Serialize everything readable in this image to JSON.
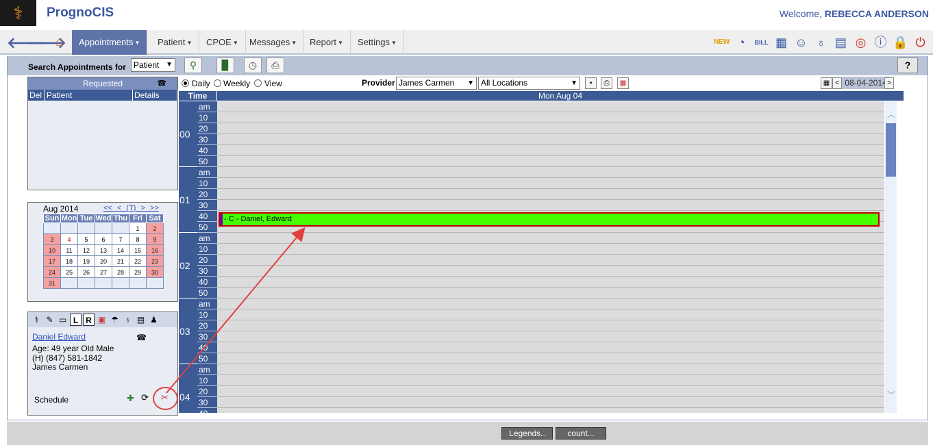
{
  "app": {
    "name": "PrognoCIS",
    "welcome_prefix": "Welcome,",
    "user": "REBECCA ANDERSON"
  },
  "nav": {
    "menus": [
      {
        "label": "Appointments",
        "active": true
      },
      {
        "label": "Patient"
      },
      {
        "label": "CPOE"
      },
      {
        "label": "Messages"
      },
      {
        "label": "Report"
      },
      {
        "label": "Settings"
      }
    ],
    "icons": [
      "new-icon",
      "dashboard-icon",
      "bill-icon",
      "calendar-icon",
      "user-icon",
      "stethoscope-icon",
      "documents-icon",
      "lifebuoy-icon",
      "info-icon",
      "lock-icon",
      "power-icon"
    ]
  },
  "toolbar": {
    "label": "Search Appointments for",
    "select_value": "Patient",
    "help": "?"
  },
  "requested": {
    "title": "Requested",
    "cols": [
      "Del",
      "Patient",
      "Details"
    ]
  },
  "calendar": {
    "month": "Aug 2014",
    "nav": [
      "<<",
      "<",
      "(T)",
      ">",
      ">>"
    ],
    "days": [
      "Sun",
      "Mon",
      "Tue",
      "Wed",
      "Thu",
      "Fri",
      "Sat"
    ],
    "weeks": [
      [
        "",
        "",
        "",
        "",
        "",
        "1",
        "2"
      ],
      [
        "3",
        "4",
        "5",
        "6",
        "7",
        "8",
        "9"
      ],
      [
        "10",
        "11",
        "12",
        "13",
        "14",
        "15",
        "16"
      ],
      [
        "17",
        "18",
        "19",
        "20",
        "21",
        "22",
        "23"
      ],
      [
        "24",
        "25",
        "26",
        "27",
        "28",
        "29",
        "30"
      ],
      [
        "31",
        "",
        "",
        "",
        "",
        "",
        ""
      ]
    ],
    "today": "4"
  },
  "patient": {
    "name": "Daniel Edward",
    "age": "Age: 49 year  Old Male",
    "phone": "(H) (847) 581-1842",
    "provider": "James Carmen",
    "schedule_label": "Schedule"
  },
  "view": {
    "options": [
      "Daily",
      "Weekly",
      "View"
    ],
    "selected": "Daily",
    "provider_label": "Provider",
    "provider_value": "James Carmen",
    "location_value": "All Locations",
    "date": "08-04-2014"
  },
  "grid": {
    "time_header": "Time",
    "day_header": "Mon Aug 04",
    "hours": [
      "00",
      "01",
      "02",
      "03",
      "04"
    ],
    "slots": [
      "am",
      "10",
      "20",
      "30",
      "40",
      "50"
    ]
  },
  "appointment": {
    "text": "- C - Daniel, Edward",
    "color": "#45ff00"
  },
  "footer": {
    "buttons": [
      "Legends..",
      "count..."
    ]
  }
}
